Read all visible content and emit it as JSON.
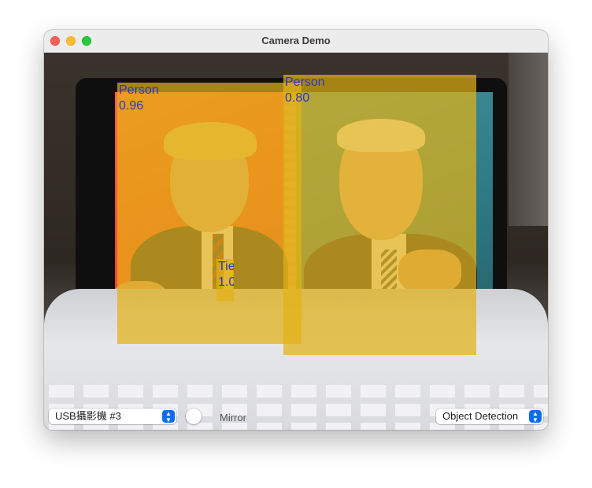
{
  "window": {
    "title": "Camera Demo"
  },
  "detections": [
    {
      "label": "Person",
      "score": "0.96"
    },
    {
      "label": "Person",
      "score": "0.80"
    },
    {
      "label": "Tie",
      "score": "1.0"
    }
  ],
  "controls": {
    "camera_select": {
      "value": "USB攝影機 #3"
    },
    "mirror_label": "Mirror",
    "mode_select": {
      "value": "Object Detection"
    }
  },
  "colors": {
    "detection_box": "#e2b218",
    "detection_text": "#2a35c8",
    "select_accent": "#0a6cf1"
  }
}
